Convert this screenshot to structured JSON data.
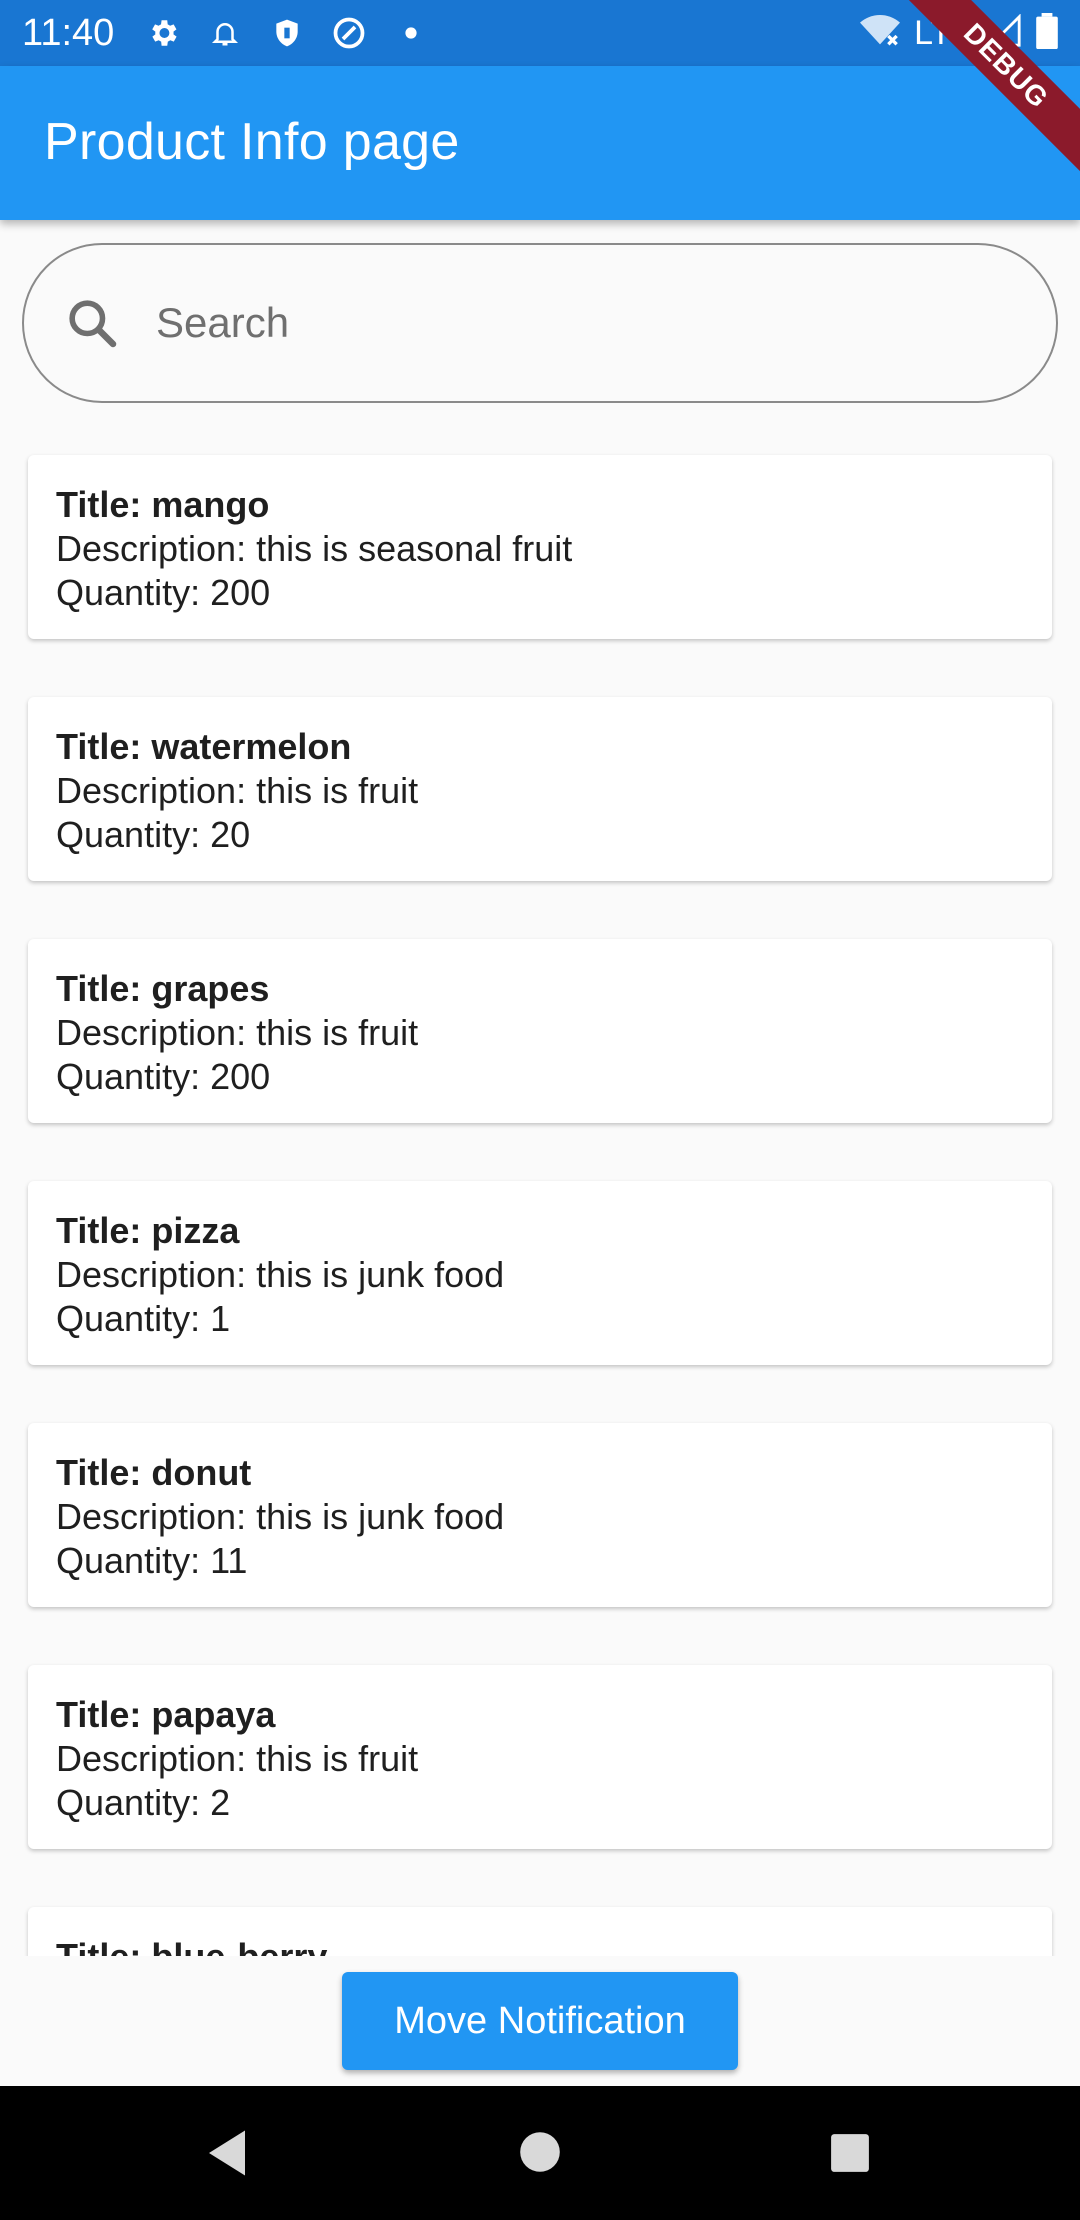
{
  "status_bar": {
    "time": "11:40",
    "network": "LTE",
    "icons": [
      "settings-icon",
      "notification-icon",
      "shield-icon",
      "vpn-icon",
      "dot-icon",
      "wifi-icon",
      "signal-icon",
      "battery-icon"
    ]
  },
  "debug_banner": "DEBUG",
  "app_bar": {
    "title": "Product Info page",
    "color": "#2196f3"
  },
  "search": {
    "placeholder": "Search",
    "value": ""
  },
  "products": [
    {
      "title": "Title: mango",
      "description": "Description: this is seasonal fruit",
      "quantity": "Quantity: 200"
    },
    {
      "title": "Title: watermelon",
      "description": "Description: this is fruit",
      "quantity": "Quantity: 20"
    },
    {
      "title": "Title: grapes",
      "description": "Description: this is fruit",
      "quantity": "Quantity: 200"
    },
    {
      "title": "Title: pizza",
      "description": "Description: this is junk food",
      "quantity": "Quantity: 1"
    },
    {
      "title": "Title: donut",
      "description": "Description: this is junk food",
      "quantity": "Quantity: 11"
    },
    {
      "title": "Title: papaya",
      "description": "Description: this is fruit",
      "quantity": "Quantity: 2"
    },
    {
      "title": "Title: blue-berry",
      "description": "",
      "quantity": ""
    }
  ],
  "footer": {
    "button_label": "Move Notification"
  }
}
